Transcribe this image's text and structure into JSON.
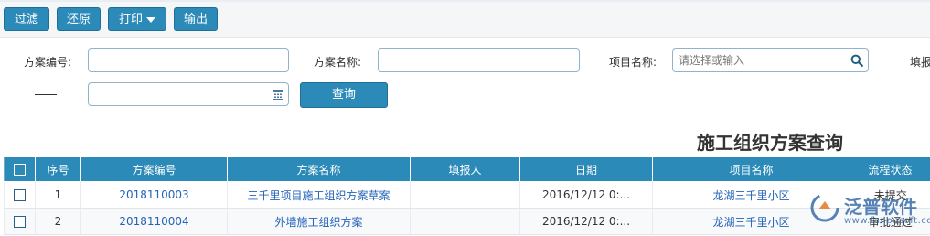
{
  "toolbar": {
    "filter_label": "过滤",
    "restore_label": "还原",
    "print_label": "打印",
    "export_label": "输出"
  },
  "filters": {
    "plan_no_label": "方案编号:",
    "plan_no_value": "",
    "plan_name_label": "方案名称:",
    "plan_name_value": "",
    "project_label": "项目名称:",
    "project_placeholder": "请选择或输入",
    "reporter_label_partial": "填报",
    "date_value": "",
    "query_label": "查询"
  },
  "page_title": "施工组织方案查询",
  "table": {
    "columns": [
      "序号",
      "方案编号",
      "方案名称",
      "填报人",
      "日期",
      "项目名称",
      "流程状态"
    ],
    "rows": [
      {
        "index": "1",
        "plan_no": "2018110003",
        "plan_name": "三千里项目施工组织方案草案",
        "reporter": "",
        "date": "2016/12/12 0:...",
        "project": "龙湖三千里小区",
        "status": "未提交"
      },
      {
        "index": "2",
        "plan_no": "2018110004",
        "plan_name": "外墙施工组织方案",
        "reporter": "",
        "date": "2016/12/12 0:...",
        "project": "龙湖三千里小区",
        "status": "审批通过"
      }
    ]
  },
  "watermark": {
    "brand": "泛普软件",
    "url": "www.fanpusoft.com"
  },
  "colors": {
    "accent": "#2b8ab8",
    "link": "#2563b8"
  }
}
